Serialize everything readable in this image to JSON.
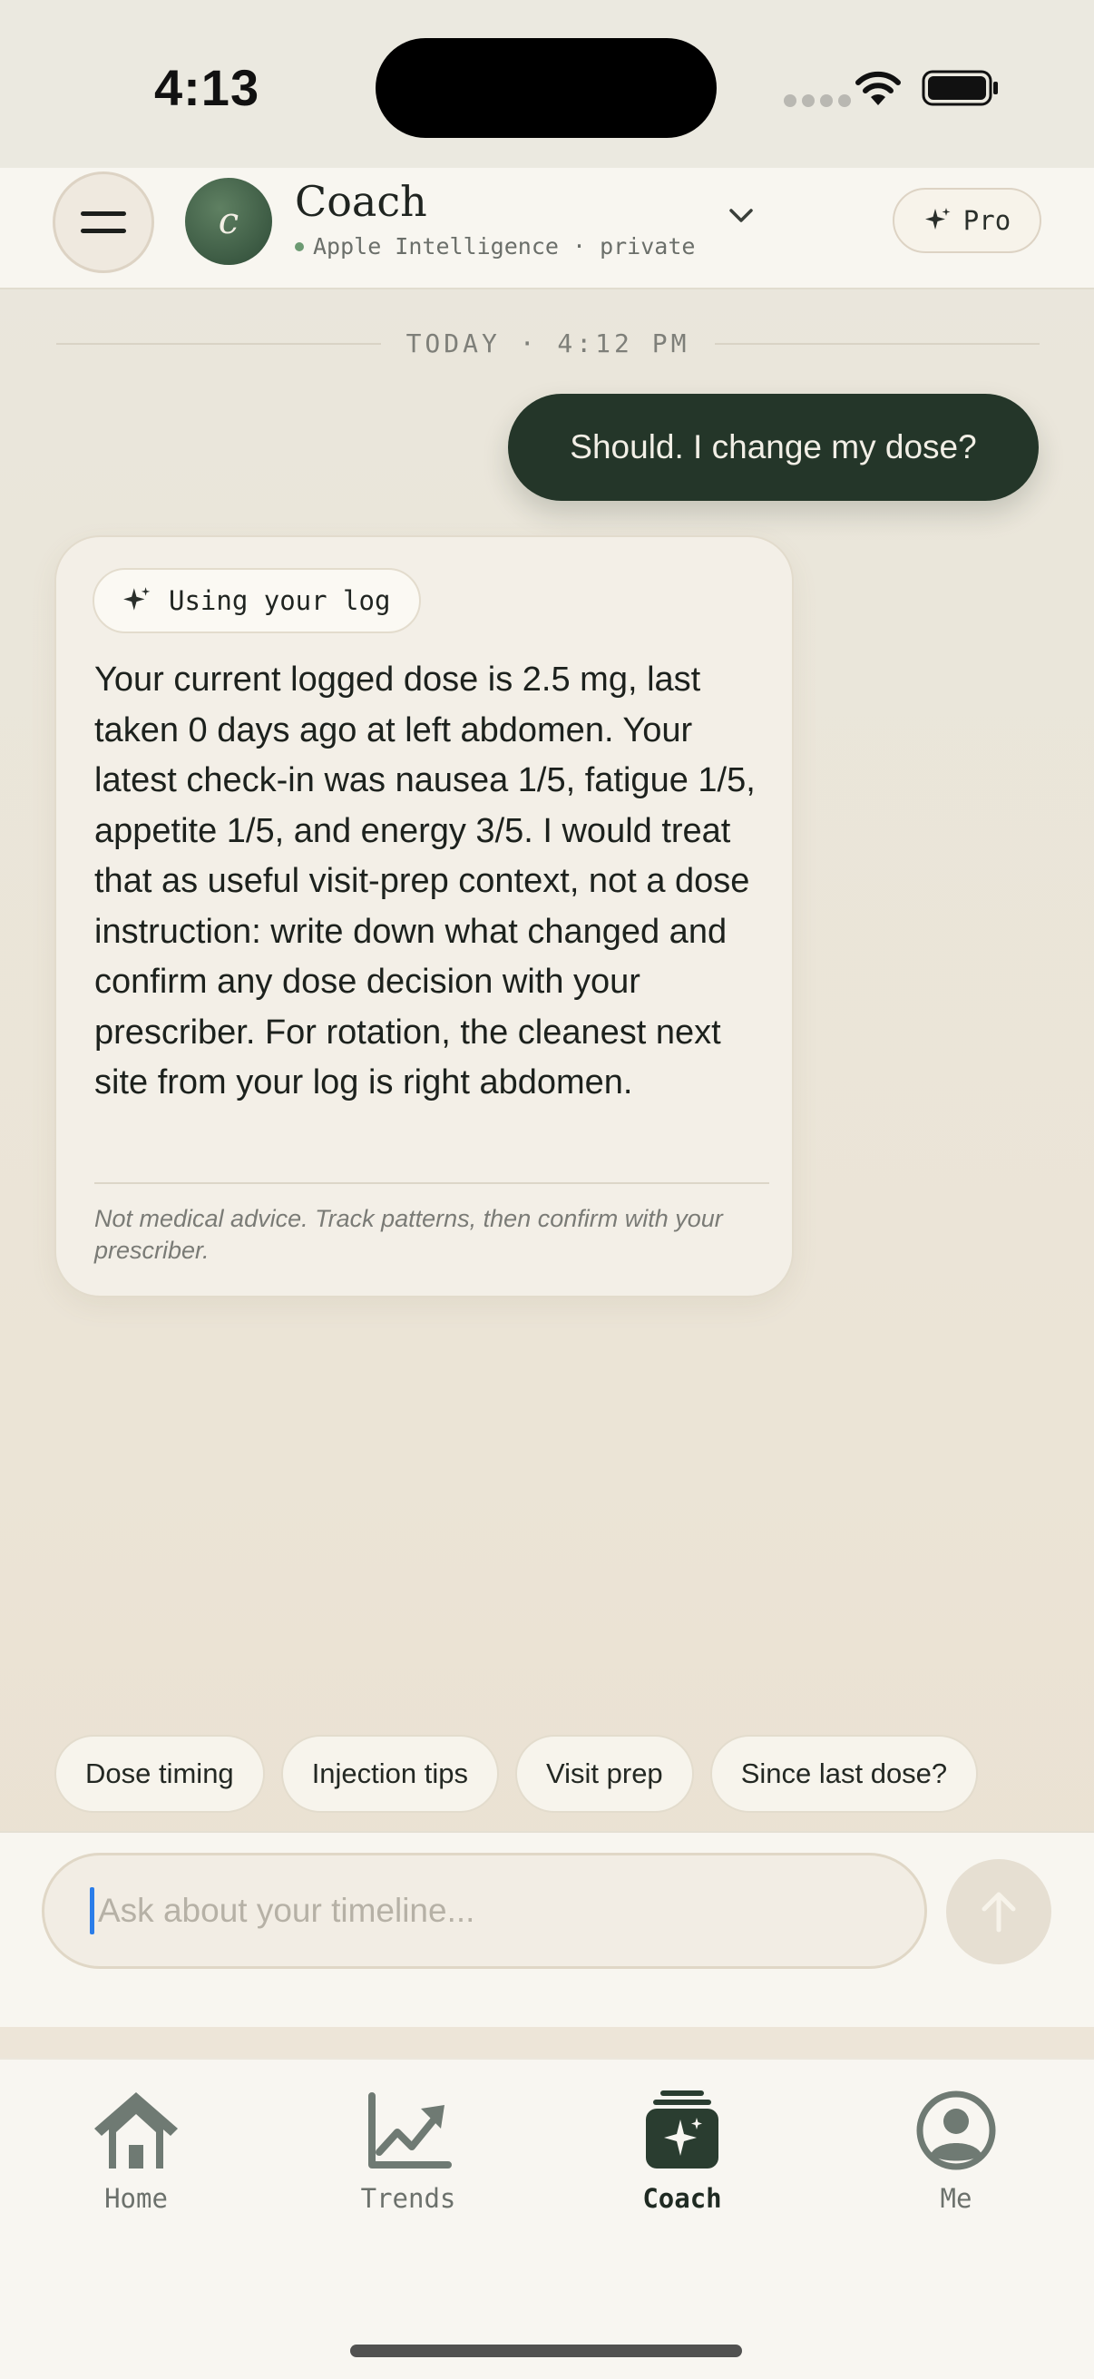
{
  "status_bar": {
    "time": "4:13"
  },
  "header": {
    "avatar_letter": "c",
    "title": "Coach",
    "subtitle": "Apple Intelligence · private",
    "pro_label": "Pro"
  },
  "chat": {
    "divider_label": "TODAY · 4:12 PM",
    "user_message": "Should. I change my dose?",
    "assistant": {
      "chip_label": "Using your log",
      "body": "Your current logged dose is 2.5 mg, last taken 0 days ago at left abdomen. Your latest check-in was nausea 1/5, fatigue 1/5, appetite 1/5, and energy 3/5. I would treat that as useful visit-prep context, not a dose instruction: write down what changed and confirm any dose decision with your prescriber. For rotation, the cleanest next site from your log is right abdomen.",
      "disclaimer": "Not medical advice. Track patterns, then confirm with your prescriber."
    }
  },
  "suggestions": [
    "Dose timing",
    "Injection tips",
    "Visit prep",
    "Since last dose?"
  ],
  "composer": {
    "placeholder": "Ask about your timeline..."
  },
  "tabs": [
    {
      "label": "Home",
      "icon": "house-icon"
    },
    {
      "label": "Trends",
      "icon": "chart-trend-icon"
    },
    {
      "label": "Coach",
      "icon": "sparkle-stack-icon",
      "active": true
    },
    {
      "label": "Me",
      "icon": "person-circle-icon"
    }
  ],
  "colors": {
    "accent_dark_green": "#243629",
    "avatar_green": "#3f5f47",
    "caret_blue": "#2b7de9"
  }
}
